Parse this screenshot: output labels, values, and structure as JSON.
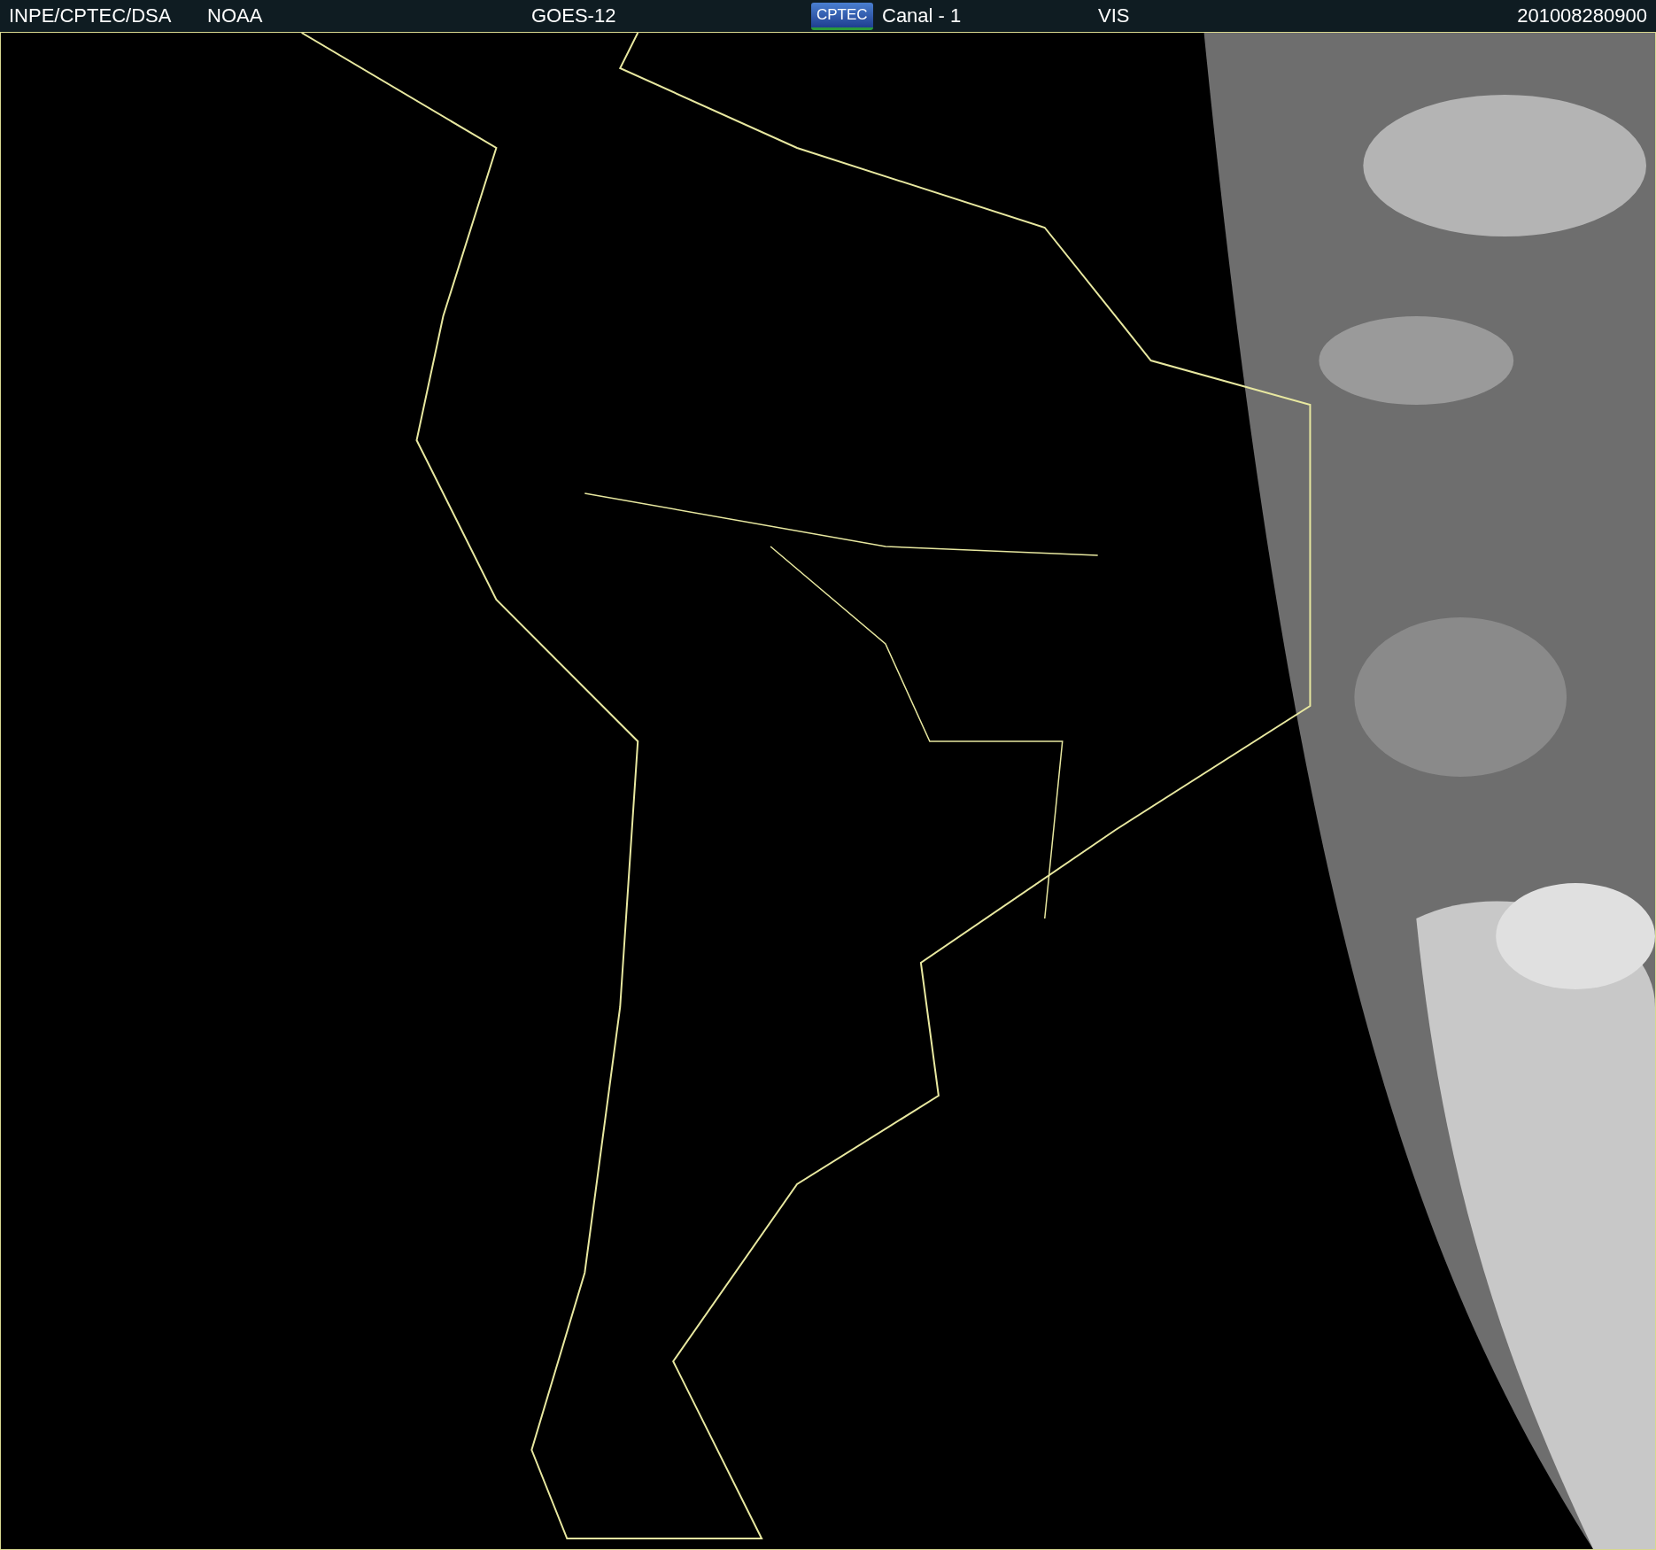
{
  "header": {
    "items": [
      {
        "kind": "text",
        "text": "INPE/CPTEC/DSA"
      },
      {
        "kind": "text",
        "text": "NOAA"
      },
      {
        "kind": "text",
        "text": "GOES-12"
      },
      {
        "kind": "logo",
        "text": "CPTEC"
      },
      {
        "kind": "text",
        "text": "Canal - 1"
      },
      {
        "kind": "text",
        "text": "VIS"
      },
      {
        "kind": "text",
        "text": "201008280900"
      }
    ]
  }
}
